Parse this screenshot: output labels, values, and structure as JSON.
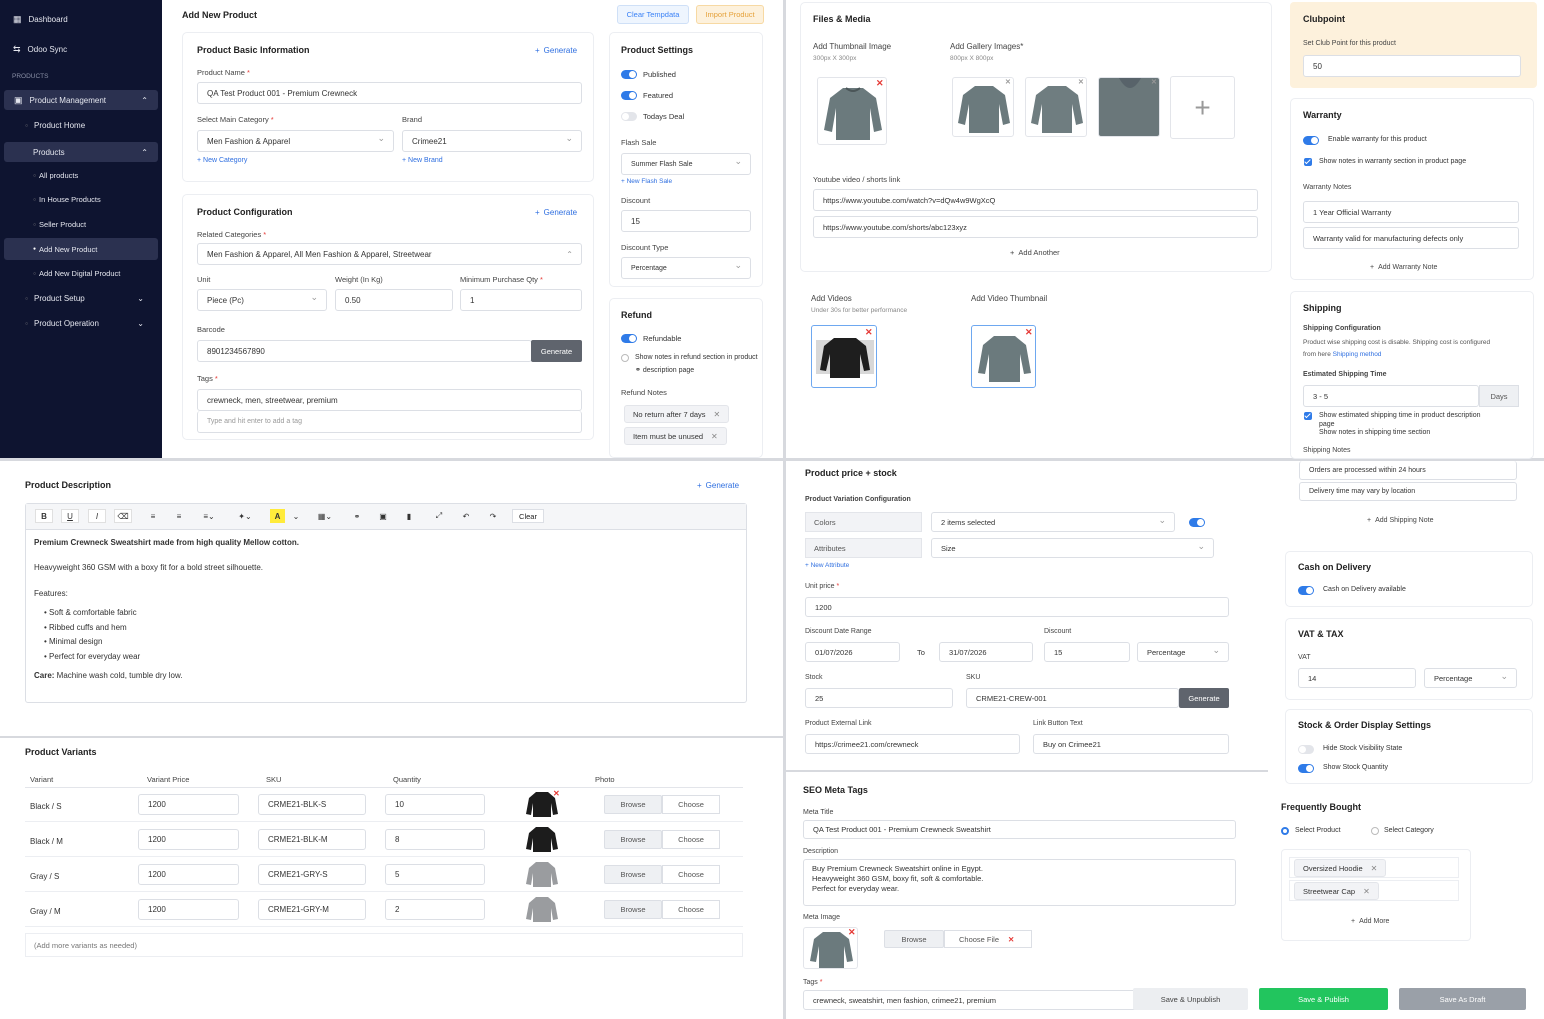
{
  "sidebar": {
    "items": [
      {
        "label": "Dashboard"
      },
      {
        "label": "Odoo Sync"
      }
    ],
    "section_label": "PRODUCTS",
    "product_management": "Product Management",
    "product_home": "Product Home",
    "products": "Products",
    "all_products": "All products",
    "in_house": "In House Products",
    "seller_product": "Seller Product",
    "add_new_product": "Add New Product",
    "add_new_digital": "Add New Digital Product",
    "product_setup": "Product Setup",
    "product_operation": "Product Operation"
  },
  "header": {
    "title": "Add New Product",
    "clear_template": "Clear Tempdata",
    "import_product": "Import Product"
  },
  "basic": {
    "title": "Product Basic Information",
    "generate": "Generate",
    "name_label": "Product Name",
    "name_value": "QA Test Product 001 - Premium Crewneck",
    "category_label": "Select Main Category",
    "category_value": "Men Fashion & Apparel",
    "brand_label": "Brand",
    "brand_value": "Crimee21",
    "new_category": "+ New Category",
    "new_brand": "+ New Brand"
  },
  "config": {
    "title": "Product Configuration",
    "generate": "Generate",
    "related_label": "Related Categories",
    "related_value": "Men Fashion & Apparel, All Men Fashion & Apparel, Streetwear",
    "unit_label": "Unit",
    "unit_value": "Piece (Pc)",
    "weight_label": "Weight (In Kg)",
    "weight_value": "0.50",
    "minqty_label": "Minimum Purchase Qty",
    "minqty_value": "1",
    "barcode_label": "Barcode",
    "barcode_value": "8901234567890",
    "barcode_btn": "Generate",
    "tags_label": "Tags",
    "tags_value": "crewneck, men, streetwear, premium",
    "tags_placeholder": "Type and hit enter to add a tag"
  },
  "settings": {
    "title": "Product Settings",
    "published": "Published",
    "featured": "Featured",
    "todays_deal": "Todays Deal",
    "flash_label": "Flash Sale",
    "flash_value": "Summer Flash Sale",
    "new_flash": "+ New Flash Sale",
    "discount_label": "Discount",
    "discount_value": "15",
    "dtype_label": "Discount Type",
    "dtype_value": "Percentage"
  },
  "refund": {
    "title": "Refund",
    "refundable": "Refundable",
    "show_notes": "Show notes in refund section in product",
    "show_notes2": "description page",
    "notes_label": "Refund Notes",
    "notes": [
      "No return after 7 days",
      "Item must be unused"
    ]
  },
  "files": {
    "title": "Files & Media",
    "thumb_label": "Add Thumbnail Image",
    "thumb_size": "300px X 300px",
    "gallery_label": "Add Gallery Images",
    "gallery_size": "800px X 800px",
    "youtube_label": "Youtube video / shorts link",
    "youtube1": "https://www.youtube.com/watch?v=dQw4w9WgXcQ",
    "youtube2": "https://www.youtube.com/shorts/abc123xyz",
    "add_another": "Add Another",
    "videos_label": "Add Videos",
    "videos_hint": "Under 30s for better performance",
    "video_thumb_label": "Add Video Thumbnail"
  },
  "clubpoint": {
    "title": "Clubpoint",
    "label": "Set Club Point for this product",
    "value": "50"
  },
  "warranty": {
    "title": "Warranty",
    "enable": "Enable warranty for this product",
    "show_notes": "Show notes in warranty section in product page",
    "notes_label": "Warranty Notes",
    "note1": "1 Year Official Warranty",
    "note2": "Warranty valid for manufacturing defects only",
    "add_note": "Add Warranty Note"
  },
  "shipping": {
    "title": "Shipping",
    "config_title": "Shipping Configuration",
    "config_text": "Product wise shipping cost is disable. Shipping cost is configured",
    "config_text2": "from here",
    "config_link": "Shipping method",
    "time_title": "Estimated Shipping Time",
    "time_value": "3 - 5",
    "time_unit": "Days",
    "show_time": "Show estimated shipping time in product description",
    "show_time2": "page",
    "show_notes": "Show notes in shipping time section",
    "notes_label": "Shipping Notes",
    "note1": "Orders are processed within 24 hours",
    "note2": "Delivery time may vary by location",
    "add_note": "Add Shipping Note"
  },
  "description": {
    "title": "Product Description",
    "generate": "Generate",
    "clear": "Clear",
    "line1": "Premium Crewneck Sweatshirt made from high quality Mellow cotton.",
    "line2": "Heavyweight 360 GSM with a boxy fit for a bold street silhouette.",
    "features_label": "Features:",
    "features": [
      "Soft & comfortable fabric",
      "Ribbed cuffs and hem",
      "Minimal design",
      "Perfect for everyday wear"
    ],
    "care_label": "Care:",
    "care_text": " Machine wash cold, tumble dry low."
  },
  "variants": {
    "title": "Product Variants",
    "headers": [
      "Variant",
      "Variant Price",
      "SKU",
      "Quantity",
      "Photo"
    ],
    "rows": [
      {
        "variant": "Black / S",
        "price": "1200",
        "sku": "CRME21-BLK-S",
        "qty": "10",
        "color": "#1c1c1c"
      },
      {
        "variant": "Black / M",
        "price": "1200",
        "sku": "CRME21-BLK-M",
        "qty": "8",
        "color": "#1c1c1c"
      },
      {
        "variant": "Gray / S",
        "price": "1200",
        "sku": "CRME21-GRY-S",
        "qty": "5",
        "color": "#9a9c9f"
      },
      {
        "variant": "Gray / M",
        "price": "1200",
        "sku": "CRME21-GRY-M",
        "qty": "2",
        "color": "#9a9c9f"
      }
    ],
    "browse": "Browse",
    "choose": "Choose",
    "more": "(Add more variants as needed)"
  },
  "price": {
    "title": "Product price + stock",
    "variation_title": "Product Variation Configuration",
    "colors_label": "Colors",
    "colors_value": "2 items selected",
    "attributes_label": "Attributes",
    "attributes_value": "Size",
    "new_attribute": "+ New Attribute",
    "unit_label": "Unit price",
    "unit_value": "1200",
    "range_label": "Discount Date Range",
    "from": "01/07/2026",
    "to_label": "To",
    "to": "31/07/2026",
    "discount_label": "Discount",
    "discount_value": "15",
    "discount_type": "Percentage",
    "stock_label": "Stock",
    "stock_value": "25",
    "sku_label": "SKU",
    "sku_value": "CRME21-CREW-001",
    "sku_btn": "Generate",
    "ext_label": "Product External Link",
    "ext_value": "https://crimee21.com/crewneck",
    "btn_text_label": "Link Button Text",
    "btn_text_value": "Buy on Crimee21"
  },
  "seo": {
    "title": "SEO Meta Tags",
    "meta_title_label": "Meta Title",
    "meta_title_value": "QA Test Product 001 - Premium Crewneck Sweatshirt",
    "desc_label": "Description",
    "desc1": "Buy Premium Crewneck Sweatshirt online in Egypt.",
    "desc2": "Heavyweight 360 GSM, boxy fit, soft & comfortable.",
    "desc3": "Perfect for everyday wear.",
    "meta_image_label": "Meta Image",
    "browse": "Browse",
    "choose_file": "Choose File",
    "tags_label": "Tags",
    "tags_value": "crewneck, sweatshirt, men fashion, crimee21, premium"
  },
  "cod": {
    "title": "Cash on Delivery",
    "label": "Cash on Delivery available"
  },
  "vat": {
    "title": "VAT & TAX",
    "label": "VAT",
    "value": "14",
    "type": "Percentage"
  },
  "stock_display": {
    "title": "Stock & Order Display Settings",
    "hide": "Hide Stock Visibility State",
    "show": "Show Stock Quantity"
  },
  "frequent": {
    "title": "Frequently Bought",
    "select_product": "Select Product",
    "select_category": "Select Category",
    "items": [
      "Oversized Hoodie",
      "Streetwear Cap"
    ],
    "add_more": "Add More"
  },
  "footer": {
    "unpublish": "Save & Unpublish",
    "publish": "Save & Publish",
    "draft": "Save As Draft"
  },
  "colors": {
    "accent": "#2f7be8",
    "sidebar": "#0e1430",
    "publish": "#22c55e",
    "clubpoint_bg": "#fdf1dc"
  }
}
